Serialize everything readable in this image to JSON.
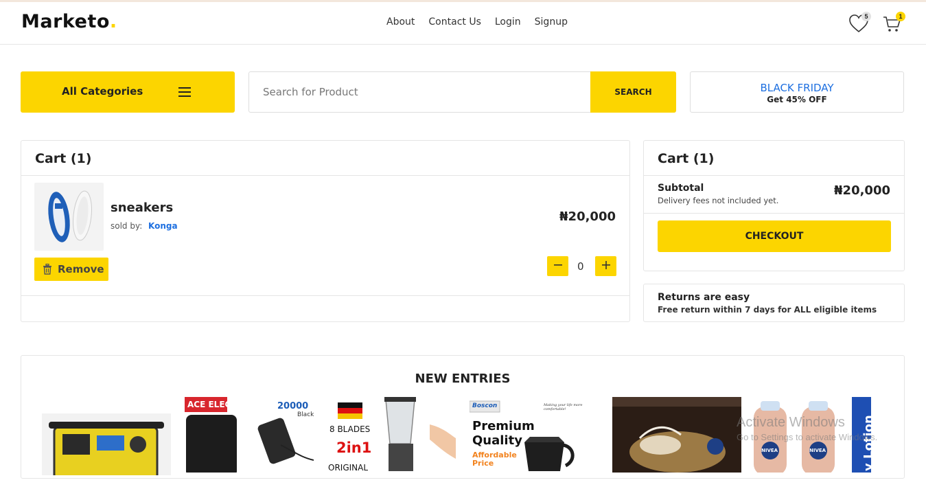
{
  "brand": {
    "name": "Marketo",
    "dot": "."
  },
  "nav": {
    "items": [
      "About",
      "Contact Us",
      "Login",
      "Signup"
    ]
  },
  "header_icons": {
    "wishlist_count": "5",
    "cart_count": "1",
    "wishlist_icon": "heart-icon",
    "cart_icon": "cart-icon"
  },
  "category": {
    "label": "All Categories",
    "icon": "hamburger-icon"
  },
  "search": {
    "placeholder": "Search for Product",
    "button": "SEARCH"
  },
  "promo": {
    "title": "BLACK FRIDAY",
    "subtitle": "Get 45% OFF"
  },
  "cart": {
    "title": "Cart (1)",
    "item": {
      "name": "sneakers",
      "sold_by_label": "sold by:",
      "seller": "Konga",
      "price": "₦20,000",
      "quantity": "0"
    },
    "remove_label": "Remove"
  },
  "summary": {
    "title": "Cart (1)",
    "subtotal_label": "Subtotal",
    "delivery_note": "Delivery fees not included yet.",
    "subtotal_value": "₦20,000",
    "checkout_label": "CHECKOUT"
  },
  "returns": {
    "title": "Returns are easy",
    "detail": "Free return within 7 days for ALL eligible items"
  },
  "entries": {
    "title": "NEW ENTRIES",
    "products": [
      {
        "texts": []
      },
      {
        "texts": [
          "ACE ELEC",
          "20000",
          "Black"
        ]
      },
      {
        "texts": [
          "8 BLADES",
          "2in1",
          "ORIGINAL"
        ]
      },
      {
        "texts": [
          "Boscon",
          "Making your life more comfortable!",
          "Premium",
          "Quality",
          "Affordable",
          "Price"
        ]
      },
      {
        "texts": []
      },
      {
        "texts": [
          "NIVEA",
          "NIVEA",
          "y Lotion"
        ]
      }
    ]
  },
  "os_watermark": {
    "line1": "Activate Windows",
    "line2": "Go to Settings to activate Windows."
  },
  "colors": {
    "accent": "#fcd500",
    "link": "#1d6fe0"
  }
}
